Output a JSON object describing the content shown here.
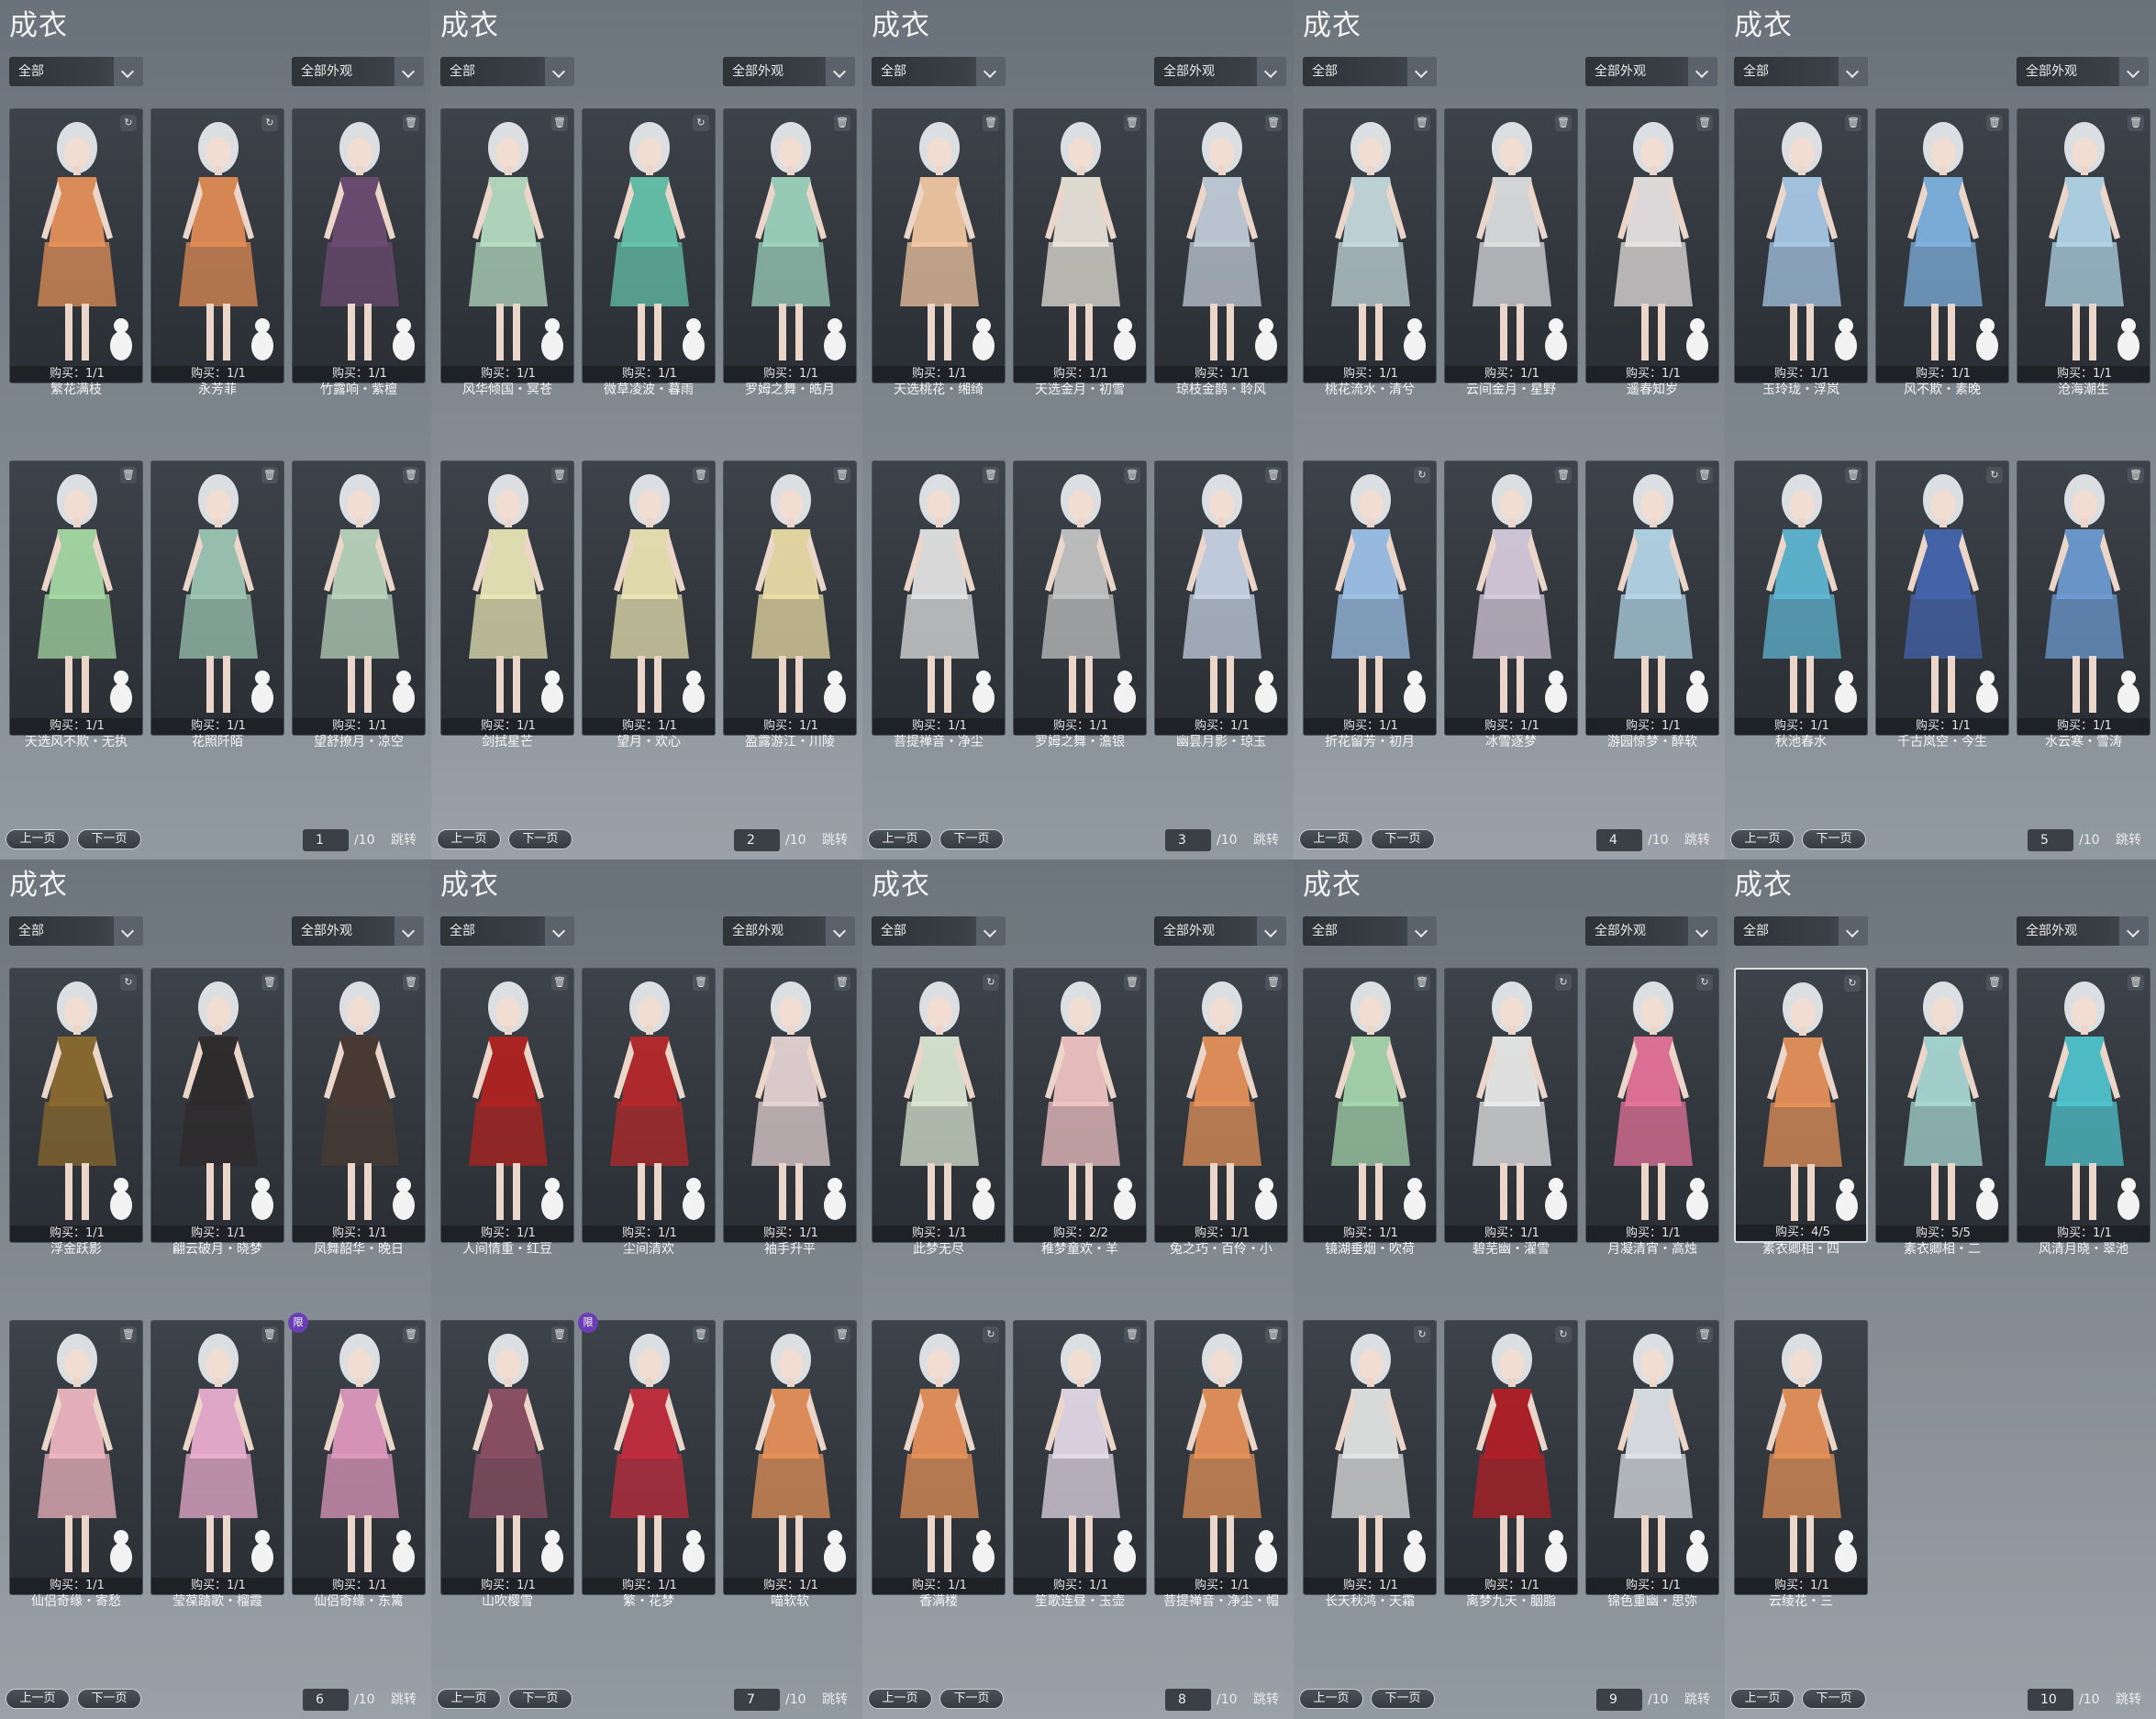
{
  "panel_title": "成衣",
  "filter_all": "全部",
  "filter_appearance": "全部外观",
  "prev_label": "上一页",
  "next_label": "下一页",
  "jump_label": "跳转",
  "page_total": "/10",
  "panels": [
    {
      "page": "1",
      "items": [
        {
          "name": "繁花满枝",
          "buy": "购买：1/1",
          "color": "#e8935a",
          "badge": "refresh-icon"
        },
        {
          "name": "永芳菲",
          "buy": "购买：1/1",
          "color": "#e38d55",
          "badge": "refresh-icon"
        },
        {
          "name": "竹露响・紫檀",
          "buy": "购买：1/1",
          "color": "#6e4c73",
          "badge": "trash-icon"
        },
        {
          "name": "天选风不欺・无执",
          "buy": "购买：1/1",
          "color": "#a8dca6",
          "badge": "trash-icon"
        },
        {
          "name": "花照阡陌",
          "buy": "购买：1/1",
          "color": "#9ec9b6",
          "badge": "trash-icon"
        },
        {
          "name": "望舒撩月・凉空",
          "buy": "购买：1/1",
          "color": "#bcd7be",
          "badge": "trash-icon"
        }
      ]
    },
    {
      "page": "2",
      "items": [
        {
          "name": "风华倾国・冥苍",
          "buy": "购买：1/1",
          "color": "#b9e0c3",
          "badge": "trash-icon"
        },
        {
          "name": "微草凌波・暮雨",
          "buy": "购买：1/1",
          "color": "#66c6ae",
          "badge": "refresh-icon"
        },
        {
          "name": "罗姆之舞・皓月",
          "buy": "购买：1/1",
          "color": "#9ed6c0",
          "badge": "trash-icon"
        },
        {
          "name": "剑拭星芒",
          "buy": "购买：1/1",
          "color": "#ece9b8",
          "badge": "trash-icon"
        },
        {
          "name": "望月・欢心",
          "buy": "购买：1/1",
          "color": "#efe7b5",
          "badge": "trash-icon"
        },
        {
          "name": "盈露游江・川陵",
          "buy": "购买：1/1",
          "color": "#eee0a8",
          "badge": "trash-icon"
        }
      ]
    },
    {
      "page": "3",
      "items": [
        {
          "name": "天选桃花・缃绮",
          "buy": "购买：1/1",
          "color": "#f4caa4",
          "badge": "trash-icon"
        },
        {
          "name": "天选金月・初雪",
          "buy": "购买：1/1",
          "color": "#ece7dc",
          "badge": "trash-icon"
        },
        {
          "name": "琼枝金鹊・聆风",
          "buy": "购买：1/1",
          "color": "#c3cfdb",
          "badge": "trash-icon"
        },
        {
          "name": "菩提禅音・净尘",
          "buy": "购买：1/1",
          "color": "#e6e6e6",
          "badge": "trash-icon"
        },
        {
          "name": "罗姆之舞・澹银",
          "buy": "购买：1/1",
          "color": "#c6c6c6",
          "badge": "trash-icon"
        },
        {
          "name": "幽昙月影・琼玉",
          "buy": "购买：1/1",
          "color": "#cad6e6",
          "badge": "trash-icon"
        }
      ]
    },
    {
      "page": "4",
      "items": [
        {
          "name": "桃花流水・清兮",
          "buy": "购买：1/1",
          "color": "#c8dde0",
          "badge": "trash-icon"
        },
        {
          "name": "云间金月・星野",
          "buy": "购买：1/1",
          "color": "#dfe1e2",
          "badge": "trash-icon"
        },
        {
          "name": "遥春知岁",
          "buy": "购买：1/1",
          "color": "#ece6e6",
          "badge": "trash-icon"
        },
        {
          "name": "折花留芳・初月",
          "buy": "购买：1/1",
          "color": "#9ec4ea",
          "badge": "refresh-icon"
        },
        {
          "name": "冰雪逐梦",
          "buy": "购买：1/1",
          "color": "#d8cde0",
          "badge": "trash-icon"
        },
        {
          "name": "游园惊梦・醉软",
          "buy": "购买：1/1",
          "color": "#b6d9ea",
          "badge": "trash-icon"
        }
      ]
    },
    {
      "page": "5",
      "items": [
        {
          "name": "玉玲珑・浮岚",
          "buy": "购买：1/1",
          "color": "#a9cbe9",
          "badge": "trash-icon"
        },
        {
          "name": "风不欺・素晚",
          "buy": "购买：1/1",
          "color": "#7fb4e2",
          "badge": "trash-icon"
        },
        {
          "name": "沧海潮生",
          "buy": "购买：1/1",
          "color": "#b4d8ea",
          "badge": "trash-icon"
        },
        {
          "name": "秋池春水",
          "buy": "购买：1/1",
          "color": "#5fb8d4",
          "badge": "trash-icon"
        },
        {
          "name": "千古岚空・今生",
          "buy": "购买：1/1",
          "color": "#4466b0",
          "badge": "refresh-icon"
        },
        {
          "name": "水云寒・雪涛",
          "buy": "购买：1/1",
          "color": "#6e9cd4",
          "badge": "trash-icon"
        }
      ]
    },
    {
      "page": "6",
      "items": [
        {
          "name": "浮金跃影",
          "buy": "购买：1/1",
          "color": "#8c6b2e",
          "badge": "refresh-icon"
        },
        {
          "name": "翩云破月・晓梦",
          "buy": "购买：1/1",
          "color": "#2e2a2a",
          "badge": "trash-icon"
        },
        {
          "name": "凤舞韶华・晚日",
          "buy": "购买：1/1",
          "color": "#4a3a32",
          "badge": "trash-icon"
        },
        {
          "name": "仙侣奇缘・寄愁",
          "buy": "购买：1/1",
          "color": "#f2b8c4",
          "badge": "trash-icon"
        },
        {
          "name": "莹葆踏歌・榴霞",
          "buy": "购买：1/1",
          "color": "#eeb0d2",
          "badge": "trash-icon"
        },
        {
          "name": "仙侣奇缘・东篱",
          "buy": "购买：1/1",
          "color": "#e29ac0",
          "badge": "trash-icon",
          "limit": "限"
        }
      ]
    },
    {
      "page": "7",
      "items": [
        {
          "name": "人间情重・红豆",
          "buy": "购买：1/1",
          "color": "#b3221f",
          "badge": "trash-icon"
        },
        {
          "name": "尘间清欢",
          "buy": "购买：1/1",
          "color": "#b8282a",
          "badge": "trash-icon"
        },
        {
          "name": "袖手升平",
          "buy": "购买：1/1",
          "color": "#e8d6d6",
          "badge": "trash-icon"
        },
        {
          "name": "山吹樱雪",
          "buy": "购买：1/1",
          "color": "#8e5064",
          "badge": "trash-icon"
        },
        {
          "name": "繁・花梦",
          "buy": "购买：1/1",
          "color": "#c52d3e",
          "badge": "trash-icon",
          "limit": "限"
        },
        {
          "name": "喵软软",
          "buy": "购买：1/1",
          "color": "#e8935a",
          "badge": "trash-icon"
        }
      ]
    },
    {
      "page": "8",
      "items": [
        {
          "name": "此梦无尽",
          "buy": "购买：1/1",
          "color": "#ddead6",
          "badge": "refresh-icon"
        },
        {
          "name": "稚梦童欢・羊",
          "buy": "购买：2/2",
          "color": "#f4c6c6",
          "badge": "trash-icon"
        },
        {
          "name": "兔之巧・百伶・小",
          "buy": "购买：1/1",
          "color": "#e8935a",
          "badge": "trash-icon"
        },
        {
          "name": "香满楼",
          "buy": "购买：1/1",
          "color": "#e8935a",
          "badge": "refresh-icon"
        },
        {
          "name": "笙歌连昼・玉壶",
          "buy": "购买：1/1",
          "color": "#e6dcec",
          "badge": "trash-icon"
        },
        {
          "name": "菩提禅音・净尘・帽",
          "buy": "购买：1/1",
          "color": "#e8935a",
          "badge": "trash-icon"
        }
      ]
    },
    {
      "page": "9",
      "items": [
        {
          "name": "镜湖垂烟・吹荷",
          "buy": "购买：1/1",
          "color": "#a8d8ae",
          "badge": "trash-icon"
        },
        {
          "name": "碧芜幽・濯雪",
          "buy": "购买：1/1",
          "color": "#eeeeee",
          "badge": "refresh-icon"
        },
        {
          "name": "月凝清宵・高烛",
          "buy": "购买：1/1",
          "color": "#e8749a",
          "badge": "refresh-icon"
        },
        {
          "name": "长天秋鸿・天霜",
          "buy": "购买：1/1",
          "color": "#e6e8e6",
          "badge": "refresh-icon"
        },
        {
          "name": "离梦九天・胭脂",
          "buy": "购买：1/1",
          "color": "#b41e26",
          "badge": "refresh-icon"
        },
        {
          "name": "锦色重幽・思弥",
          "buy": "购买：1/1",
          "color": "#e2e6ea",
          "badge": "trash-icon"
        }
      ]
    },
    {
      "page": "10",
      "items": [
        {
          "name": "素衣卿相・四",
          "buy": "购买：4/5",
          "color": "#e8935a",
          "badge": "refresh-icon",
          "selected": true
        },
        {
          "name": "素衣卿相・二",
          "buy": "购买：5/5",
          "color": "#aadbd6",
          "badge": "trash-icon"
        },
        {
          "name": "风清月晓・翠池",
          "buy": "购买：1/1",
          "color": "#4fc6cf",
          "badge": "trash-icon"
        },
        {
          "name": "云绫花・三",
          "buy": "购买：1/1",
          "color": "#e8935a",
          "badge": "none"
        }
      ]
    }
  ]
}
